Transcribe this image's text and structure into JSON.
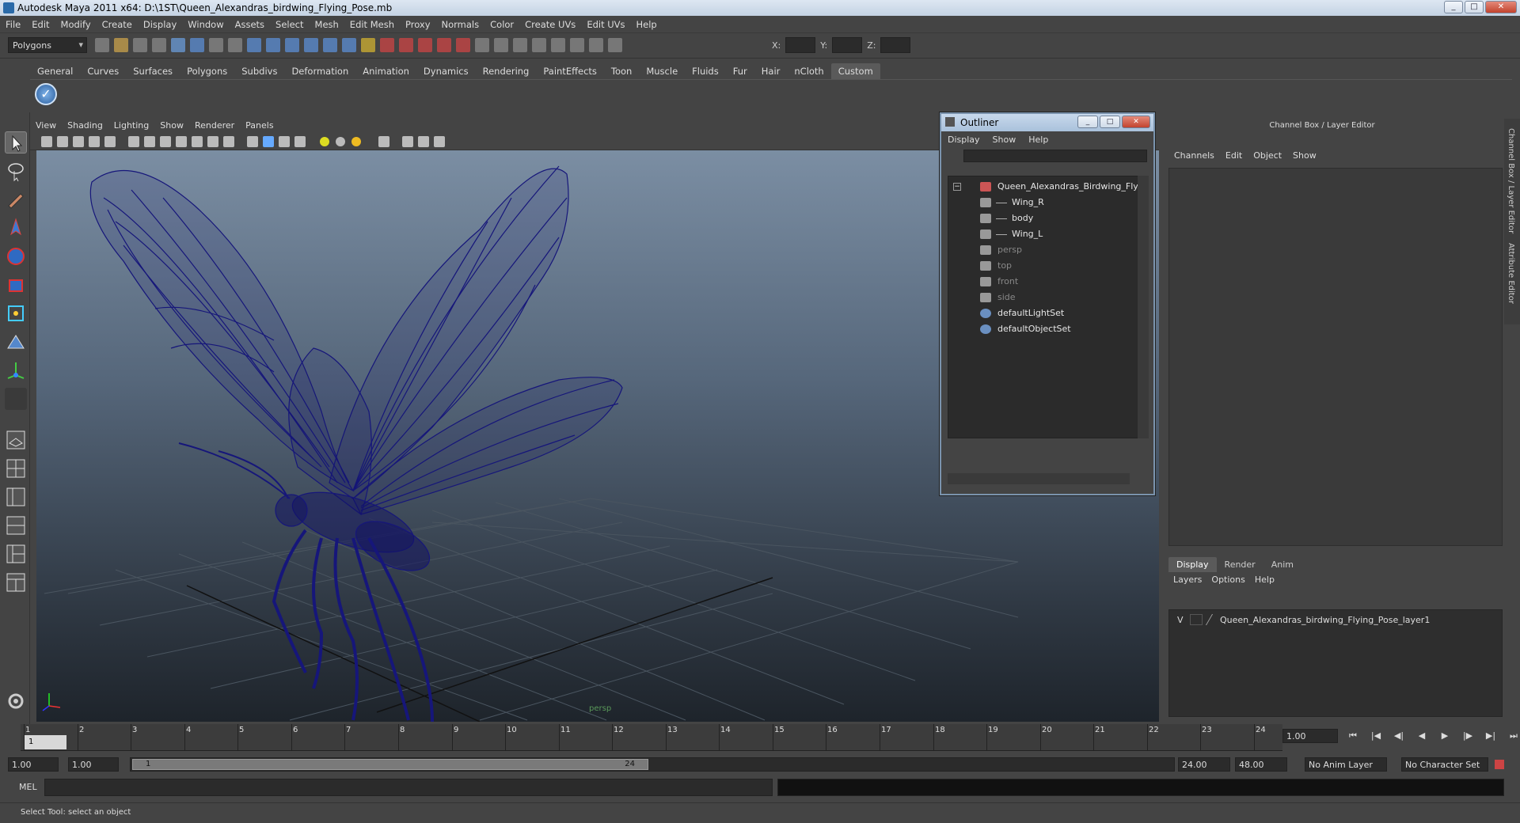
{
  "window": {
    "title": "Autodesk Maya 2011 x64: D:\\1ST\\Queen_Alexandras_birdwing_Flying_Pose.mb"
  },
  "menubar": [
    "File",
    "Edit",
    "Modify",
    "Create",
    "Display",
    "Window",
    "Assets",
    "Select",
    "Mesh",
    "Edit Mesh",
    "Proxy",
    "Normals",
    "Color",
    "Create UVs",
    "Edit UVs",
    "Help"
  ],
  "status": {
    "mode": "Polygons",
    "x_label": "X:",
    "y_label": "Y:",
    "z_label": "Z:"
  },
  "shelf_tabs": [
    "General",
    "Curves",
    "Surfaces",
    "Polygons",
    "Subdivs",
    "Deformation",
    "Animation",
    "Dynamics",
    "Rendering",
    "PaintEffects",
    "Toon",
    "Muscle",
    "Fluids",
    "Fur",
    "Hair",
    "nCloth",
    "Custom"
  ],
  "shelf_active": "Custom",
  "panel_menu": [
    "View",
    "Shading",
    "Lighting",
    "Show",
    "Renderer",
    "Panels"
  ],
  "viewport": {
    "camera_label": "persp",
    "wire_color": "#1a1a7a"
  },
  "outliner": {
    "title": "Outliner",
    "menu": [
      "Display",
      "Show",
      "Help"
    ],
    "items": [
      {
        "label": "Queen_Alexandras_Birdwing_Flyin",
        "indent": 0,
        "dim": false,
        "icon": "transform-icon"
      },
      {
        "label": "Wing_R",
        "indent": 1,
        "dim": false,
        "icon": "mesh-icon"
      },
      {
        "label": "body",
        "indent": 1,
        "dim": false,
        "icon": "mesh-icon"
      },
      {
        "label": "Wing_L",
        "indent": 1,
        "dim": false,
        "icon": "mesh-icon"
      },
      {
        "label": "persp",
        "indent": 0,
        "dim": true,
        "icon": "camera-icon"
      },
      {
        "label": "top",
        "indent": 0,
        "dim": true,
        "icon": "camera-icon"
      },
      {
        "label": "front",
        "indent": 0,
        "dim": true,
        "icon": "camera-icon"
      },
      {
        "label": "side",
        "indent": 0,
        "dim": true,
        "icon": "camera-icon"
      },
      {
        "label": "defaultLightSet",
        "indent": 0,
        "dim": false,
        "icon": "set-icon"
      },
      {
        "label": "defaultObjectSet",
        "indent": 0,
        "dim": false,
        "icon": "set-icon"
      }
    ]
  },
  "channel_box": {
    "title": "Channel Box / Layer Editor",
    "menu": [
      "Channels",
      "Edit",
      "Object",
      "Show"
    ],
    "layer_tabs": [
      "Display",
      "Render",
      "Anim"
    ],
    "layer_menu": [
      "Layers",
      "Options",
      "Help"
    ],
    "layer_visible": "V",
    "layer_name": "Queen_Alexandras_birdwing_Flying_Pose_layer1",
    "side_tabs": [
      "Channel Box / Layer Editor",
      "Attribute Editor"
    ]
  },
  "timeline": {
    "ticks": [
      "1",
      "2",
      "3",
      "4",
      "5",
      "6",
      "7",
      "8",
      "9",
      "10",
      "11",
      "12",
      "13",
      "14",
      "15",
      "16",
      "17",
      "18",
      "19",
      "20",
      "21",
      "22",
      "23",
      "24"
    ],
    "current_frame": "1",
    "current_time": "1.00"
  },
  "range": {
    "start": "1.00",
    "playback_start": "1.00",
    "handle_start": "1",
    "handle_end": "24",
    "playback_end": "24.00",
    "end": "48.00",
    "anim_layer": "No Anim Layer",
    "char_set": "No Character Set"
  },
  "cmdline": {
    "label": "MEL"
  },
  "help_line": "Select Tool: select an object"
}
